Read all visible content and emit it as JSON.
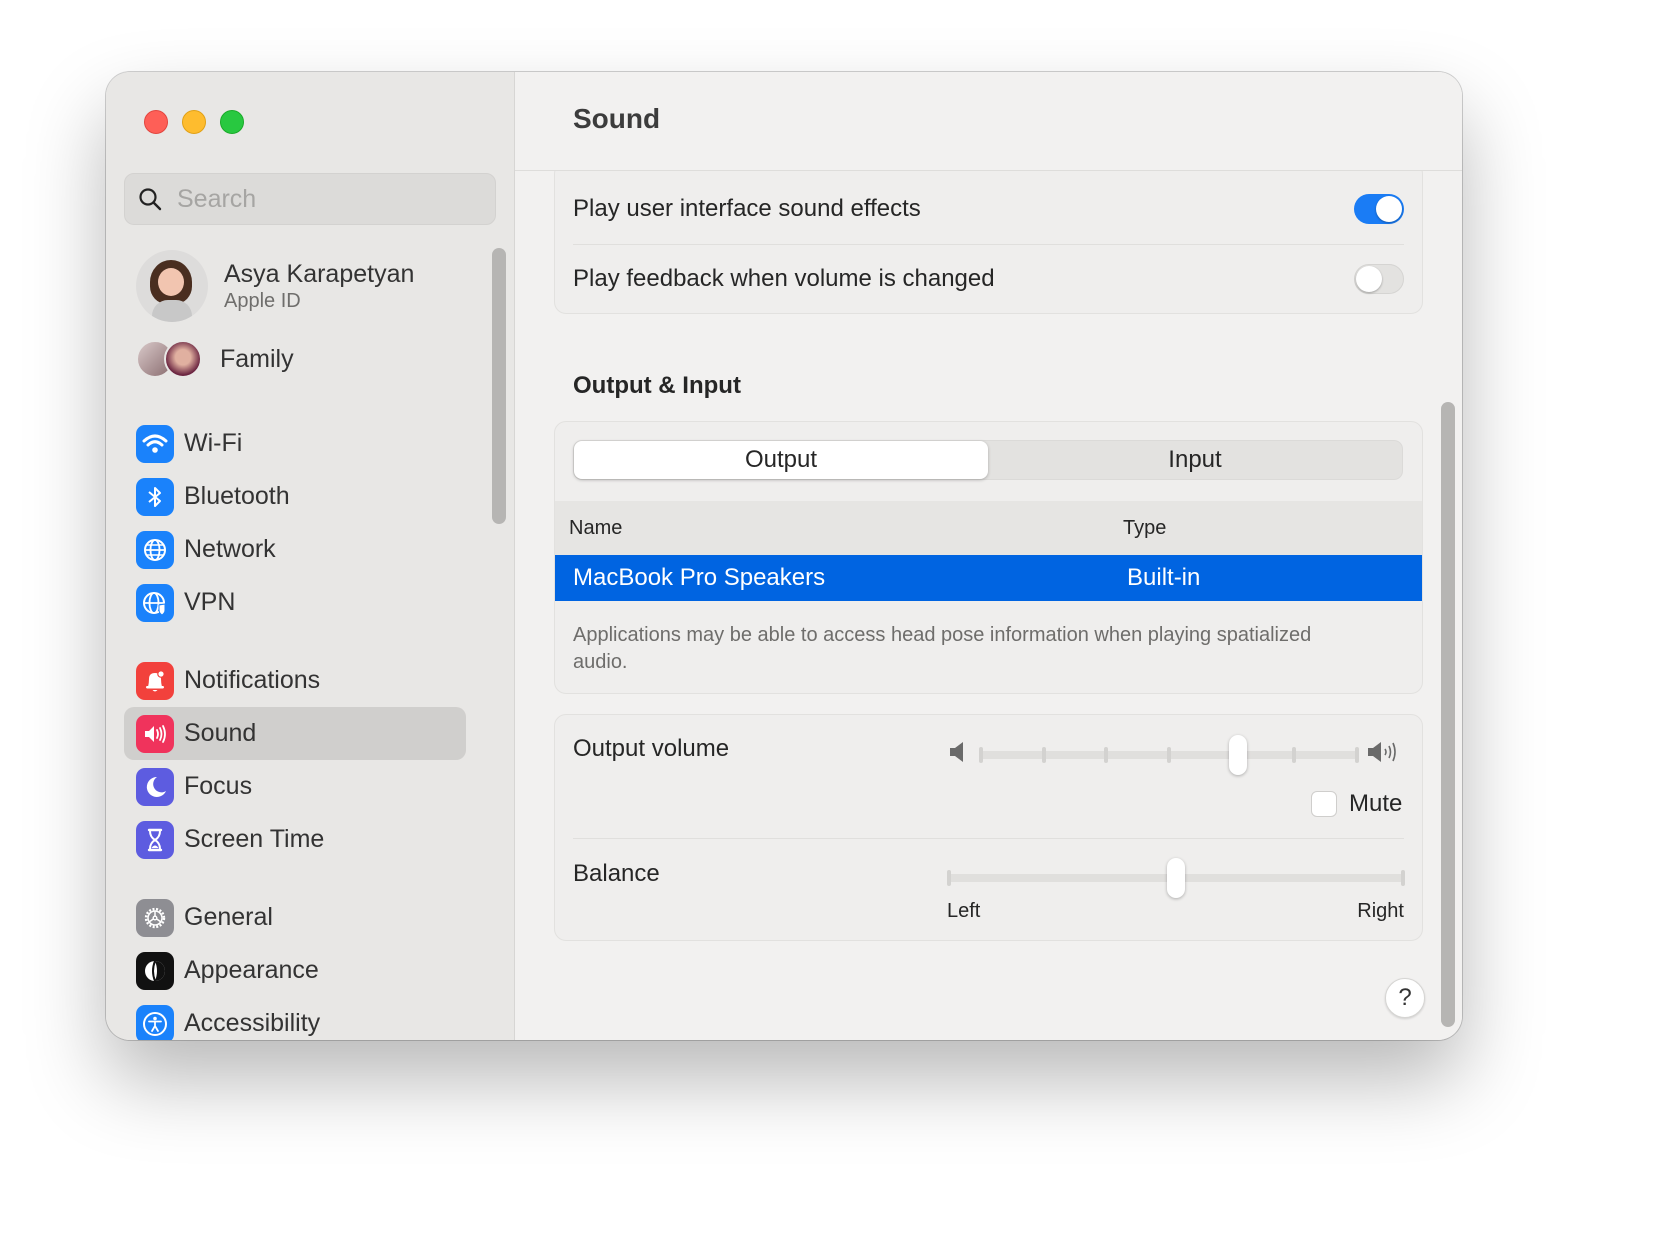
{
  "window": {
    "title": "Sound"
  },
  "sidebar": {
    "search_placeholder": "Search",
    "account": {
      "name": "Asya Karapetyan",
      "subtitle": "Apple ID"
    },
    "family_label": "Family",
    "groups": [
      [
        {
          "label": "Wi-Fi",
          "icon": "wifi-icon",
          "color": "#1a82fb"
        },
        {
          "label": "Bluetooth",
          "icon": "bluetooth-icon",
          "color": "#1a82fb"
        },
        {
          "label": "Network",
          "icon": "globe-icon",
          "color": "#1a82fb"
        },
        {
          "label": "VPN",
          "icon": "vpn-globe-icon",
          "color": "#1a82fb"
        }
      ],
      [
        {
          "label": "Notifications",
          "icon": "bell-icon",
          "color": "#f2413c"
        },
        {
          "label": "Sound",
          "icon": "speaker-icon",
          "color": "#f0335c",
          "active": true
        },
        {
          "label": "Focus",
          "icon": "moon-icon",
          "color": "#5d5ce0"
        },
        {
          "label": "Screen Time",
          "icon": "hourglass-icon",
          "color": "#5d5ce0"
        }
      ],
      [
        {
          "label": "General",
          "icon": "gear-icon",
          "color": "#8e8e93"
        },
        {
          "label": "Appearance",
          "icon": "appearance-icon",
          "color": "#111111"
        },
        {
          "label": "Accessibility",
          "icon": "accessibility-icon",
          "color": "#1a82fb"
        }
      ]
    ]
  },
  "main": {
    "title": "Sound",
    "toggles": [
      {
        "label": "Play user interface sound effects",
        "on": true
      },
      {
        "label": "Play feedback when volume is changed",
        "on": false
      }
    ],
    "output_input": {
      "section_title": "Output & Input",
      "tabs": [
        {
          "label": "Output",
          "active": true
        },
        {
          "label": "Input",
          "active": false
        }
      ],
      "columns": {
        "name": "Name",
        "type": "Type"
      },
      "rows": [
        {
          "name": "MacBook Pro Speakers",
          "type": "Built-in",
          "selected": true
        }
      ],
      "note": "Applications may be able to access head pose information when playing spatialized audio."
    },
    "output_volume": {
      "label": "Output volume",
      "value": 0.69,
      "mute_label": "Mute",
      "muted": false
    },
    "balance": {
      "label": "Balance",
      "value": 0.5,
      "left_label": "Left",
      "right_label": "Right"
    },
    "help_label": "?"
  },
  "colors": {
    "accent": "#1a7cf5",
    "selection": "#0064e1"
  }
}
